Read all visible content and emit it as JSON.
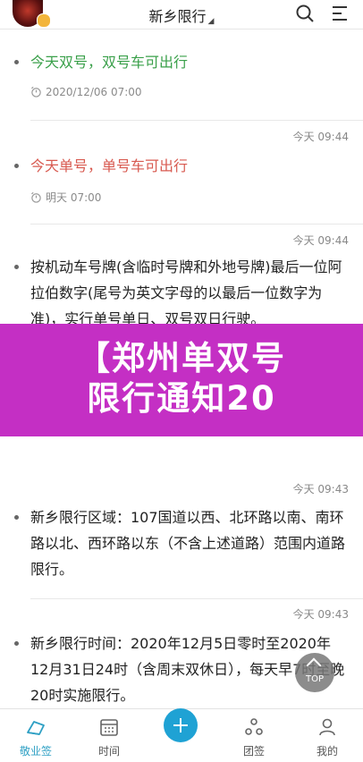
{
  "header": {
    "title": "新乡限行",
    "caret": "◢"
  },
  "messages": [
    {
      "text": "今天双号，双号车可出行",
      "sub": "2020/12/06 07:00"
    },
    {
      "time": "今天 09:44",
      "text": "今天单号，单号车可出行",
      "sub": "明天 07:00"
    },
    {
      "time": "今天 09:44",
      "text": "按机动车号牌(含临时号牌和外地号牌)最后一位阿拉伯数字(尾号为英文字母的以最后一位数字为准)，实行单号单日、双号双日行驶。"
    },
    {
      "time": "今天 09:43",
      "text": "新乡限行区域：107国道以西、北环路以南、南环路以北、西环路以东（不含上述道路）范围内道路限行。"
    },
    {
      "time": "今天 09:43",
      "text": "新乡限行时间：2020年12月5日零时至2020年12月31日24时（含周末双休日），每天早7时至晚20时实施限行。"
    }
  ],
  "banner": {
    "line1": "【郑州单双号",
    "line2": "限行通知20"
  },
  "top_button": "TOP",
  "tabs": [
    {
      "label": "敬业签",
      "icon": "note-icon",
      "active": true
    },
    {
      "label": "时间",
      "icon": "calendar-icon"
    },
    {
      "label": "",
      "icon": "plus-icon"
    },
    {
      "label": "团签",
      "icon": "team-icon"
    },
    {
      "label": "我的",
      "icon": "user-icon"
    }
  ],
  "colors": {
    "green": "#3aa04a",
    "red": "#d85a50",
    "accent": "#1fa2d4",
    "banner": "#c42fc4"
  }
}
